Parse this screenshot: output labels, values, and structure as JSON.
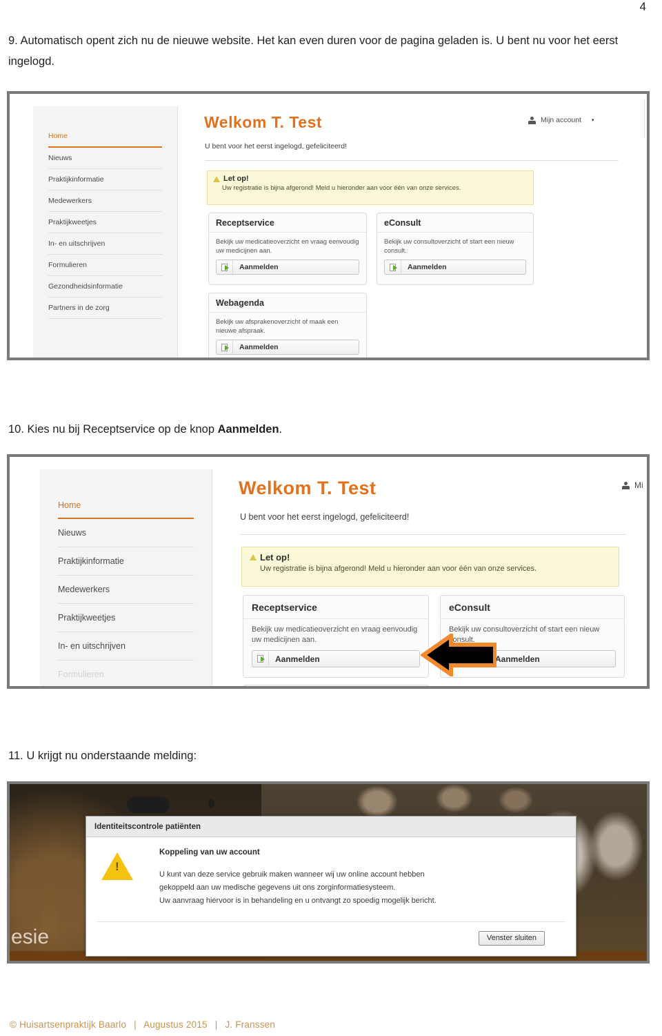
{
  "document": {
    "page_number": "4",
    "footer": {
      "copyright": "© Huisartsenpraktijk Baarlo",
      "date": "Augustus 2015",
      "author": "J. Franssen",
      "separator": "|",
      "color": "#c8934e"
    }
  },
  "steps": {
    "step9": {
      "number": "9.",
      "text": "Automatisch opent zich nu de nieuwe website. Het kan even duren voor de pagina geladen is. U bent nu voor het eerst ingelogd."
    },
    "step10": {
      "number": "10.",
      "text_before": "Kies nu bij Receptservice op de knop ",
      "bold": "Aanmelden",
      "text_after": "."
    },
    "step11": {
      "number": "11.",
      "text": "U krijgt nu onderstaande melding:"
    }
  },
  "portal": {
    "accent_color": "#e2711d",
    "welkom_title": "Welkom T. Test",
    "subline": "U bent voor het eerst ingelogd, gefeliciteerd!",
    "account": {
      "label": "Mijn account",
      "label_truncated": "Mi",
      "person_icon": "person-icon",
      "caret_icon": "chevron-down-icon"
    },
    "nav": [
      "Home",
      "Nieuws",
      "Praktijkinformatie",
      "Medewerkers",
      "Praktijkweetjes",
      "In- en uitschrijven",
      "Formulieren",
      "Gezondheidsinformatie",
      "Partners in de zorg"
    ],
    "alert": {
      "icon": "warning-triangle-icon",
      "title": "Let op!",
      "body": "Uw registratie is bijna afgerond! Meld u hieronder aan voor één van onze services.",
      "bg_color": "#fbf7d9",
      "border_color": "#e6dfa8"
    },
    "cards": [
      {
        "title": "Receptservice",
        "desc": "Bekijk uw medicatieoverzicht en vraag eenvoudig uw medicijnen aan.",
        "button_label": "Aanmelden",
        "button_icon": "page-arrow-icon"
      },
      {
        "title": "eConsult",
        "desc": "Bekijk uw consultoverzicht of start een nieuw consult.",
        "button_label": "Aanmelden",
        "button_icon": "page-arrow-icon"
      },
      {
        "title": "Webagenda",
        "desc": "Bekijk uw afsprakenoverzicht of maak een nieuwe afspraak.",
        "button_label": "Aanmelden",
        "button_icon": "page-arrow-icon"
      }
    ],
    "annotation": {
      "icon": "left-arrow-annotation",
      "fill_color": "#000000",
      "outline_color": "#f08a2c"
    }
  },
  "modal": {
    "title": "Identiteitscontrole patiënten",
    "icon": "warning-triangle-icon",
    "heading": "Koppeling van uw account",
    "lines": [
      "U kunt van deze service gebruik maken wanneer wij uw online account hebben",
      "gekoppeld aan uw medische gegevens uit ons zorginformatiesysteem.",
      "Uw aanvraag hiervoor is in behandeling en u ontvangt zo spoedig mogelijk bericht."
    ],
    "close_button": "Venster sluiten",
    "background_text": "esie"
  }
}
